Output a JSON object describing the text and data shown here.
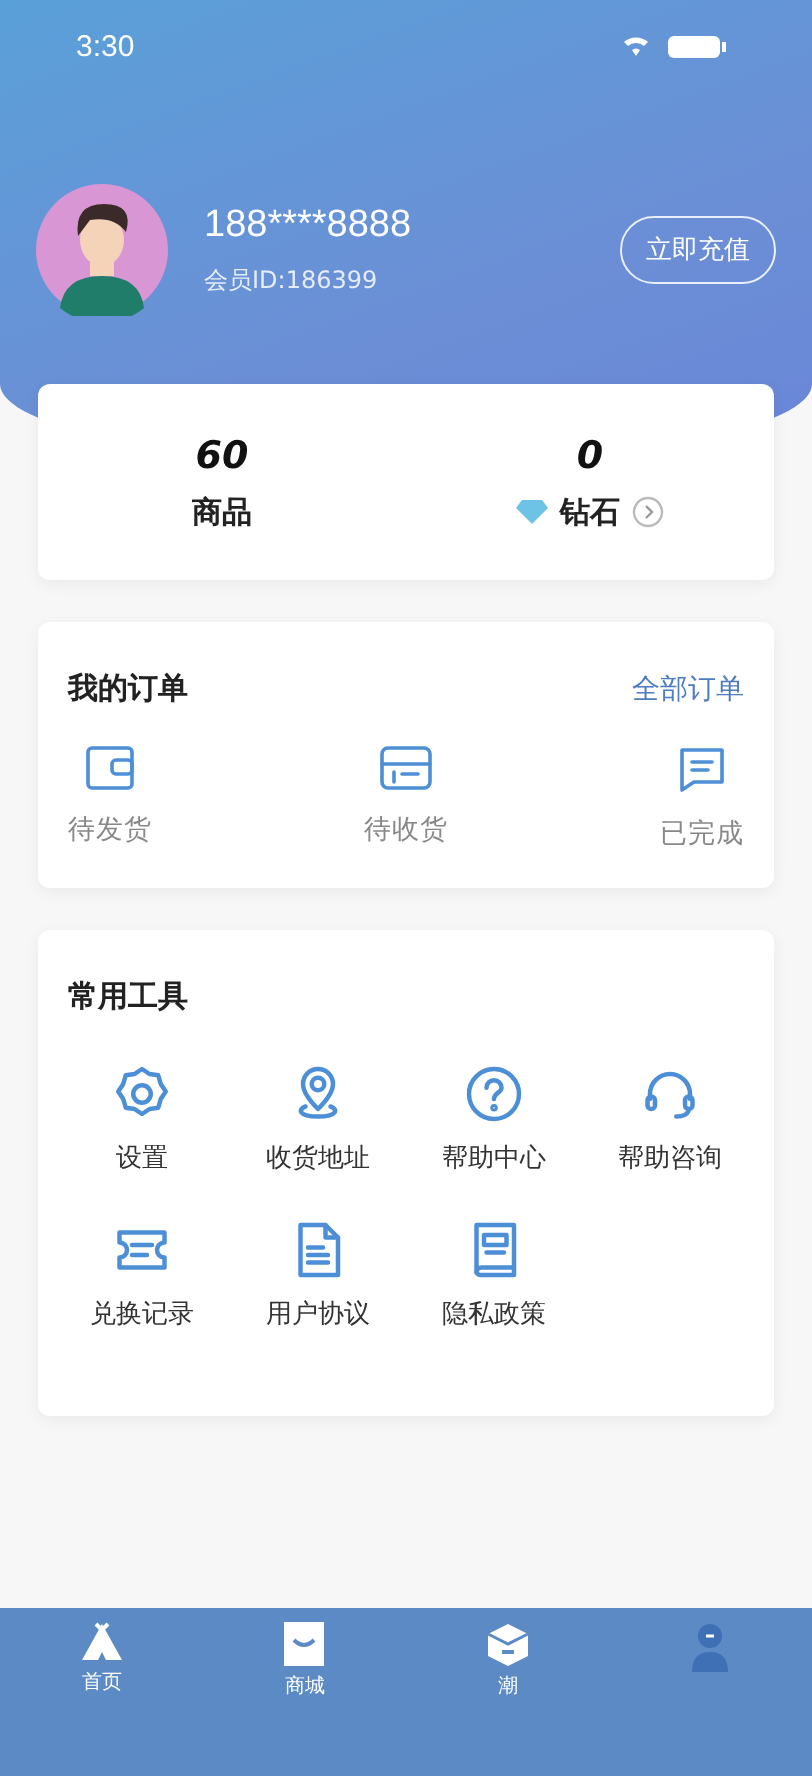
{
  "status_bar": {
    "time": "3:30"
  },
  "profile": {
    "phone": "188****8888",
    "member_id": "会员ID:186399",
    "recharge_button": "立即充值"
  },
  "stats": [
    {
      "value": "60",
      "label": "商品",
      "kind": "plain"
    },
    {
      "value": "0",
      "label": "钻石",
      "kind": "diamond"
    }
  ],
  "orders": {
    "title": "我的订单",
    "all_link": "全部订单",
    "items": [
      {
        "label": "待发货"
      },
      {
        "label": "待收货"
      },
      {
        "label": "已完成"
      }
    ]
  },
  "tools": {
    "title": "常用工具",
    "items": [
      {
        "label": "设置"
      },
      {
        "label": "收货地址"
      },
      {
        "label": "帮助中心"
      },
      {
        "label": "帮助咨询"
      },
      {
        "label": "兑换记录"
      },
      {
        "label": "用户协议"
      },
      {
        "label": "隐私政策"
      }
    ]
  },
  "tab_bar": [
    {
      "label": "首页",
      "selected": false
    },
    {
      "label": "商城",
      "selected": false
    },
    {
      "label": "潮",
      "selected": false
    },
    {
      "selected": true
    }
  ]
}
